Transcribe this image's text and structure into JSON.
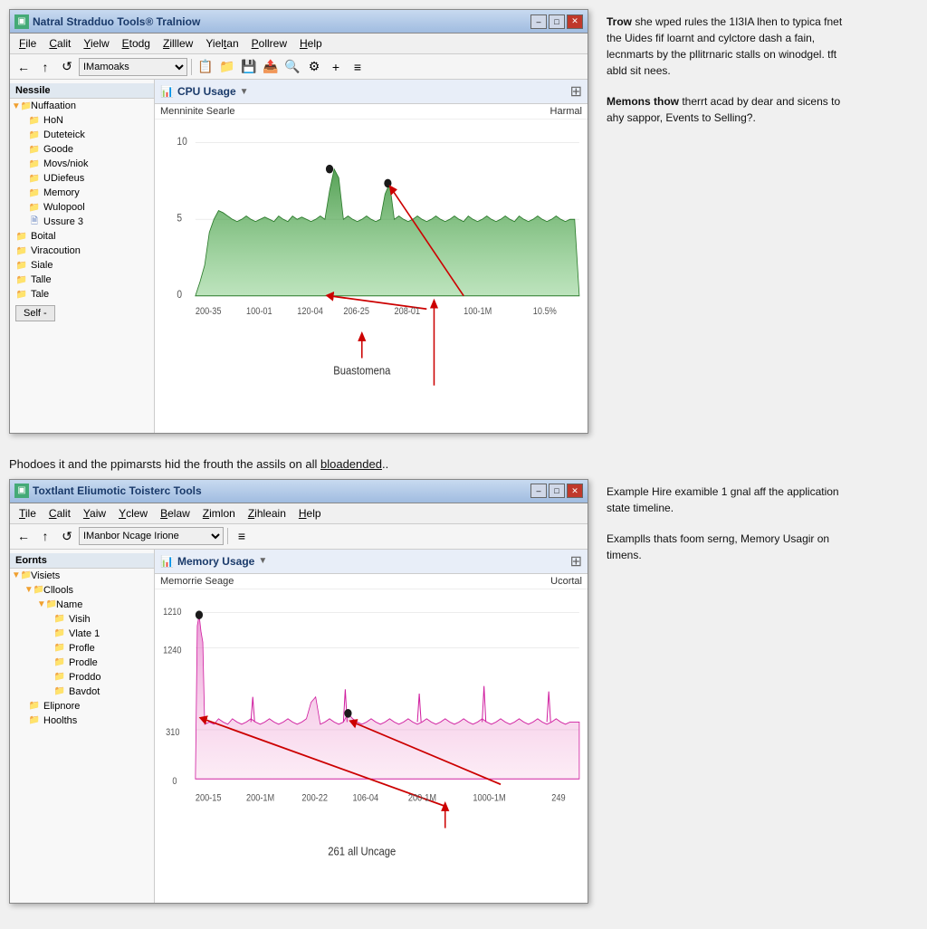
{
  "app1": {
    "title": "Natral Stradduo Tools® Tralniow",
    "menu": [
      "File",
      "Calit",
      "Yielw",
      "Etodg",
      "Zilllew",
      "Yieltan",
      "Pollrew",
      "Help"
    ],
    "toolbar_combo": "IMamoaks",
    "sidebar_header": "Nessile",
    "sidebar_items": [
      {
        "label": "Nuffaation",
        "indent": 0,
        "type": "folder"
      },
      {
        "label": "HoN",
        "indent": 1,
        "type": "folder"
      },
      {
        "label": "Duteteick",
        "indent": 1,
        "type": "folder"
      },
      {
        "label": "Goode",
        "indent": 1,
        "type": "folder"
      },
      {
        "label": "Movs/niok",
        "indent": 1,
        "type": "folder"
      },
      {
        "label": "UDiefeus",
        "indent": 1,
        "type": "folder"
      },
      {
        "label": "Memory",
        "indent": 1,
        "type": "folder"
      },
      {
        "label": "Wulopool",
        "indent": 1,
        "type": "folder"
      },
      {
        "label": "Ussure 3",
        "indent": 1,
        "type": "file"
      },
      {
        "label": "Boital",
        "indent": 0,
        "type": "folder"
      },
      {
        "label": "Viracoution",
        "indent": 0,
        "type": "folder"
      },
      {
        "label": "Siale",
        "indent": 0,
        "type": "folder"
      },
      {
        "label": "Talle",
        "indent": 0,
        "type": "folder"
      },
      {
        "label": "Tale",
        "indent": 0,
        "type": "folder"
      }
    ],
    "sidebar_btn": "Self -",
    "panel_title": "CPU Usage",
    "panel_subtitle_left": "Menninite Searle",
    "panel_subtitle_right": "Harmal",
    "chart_y_labels": [
      "10",
      "5",
      "0"
    ],
    "chart_x_labels": [
      "200-35",
      "100-01",
      "120-04",
      "206-25",
      "208-01",
      "100-1M",
      "10.5%"
    ],
    "balloon_text": "Buastomena",
    "annotation1_title": "Trow",
    "annotation1_body": "she wped rules the 1I3IA lhen to typica fnet the Uides fif loarnt and cylctore dash a fain, lecnmarts by the pllitrnaric stalls on winodgel. tft abld sit nees.",
    "annotation2_title": "Memons thow",
    "annotation2_body": "therrt acad by dear and sicens to ahy sappor, Events to Selling?."
  },
  "middle_text": "Phodoes it and the ppimarsts hid the frouth the assils on all bloadended..",
  "app2": {
    "title": "Toxtlant Eliumotic Toisterc Tools",
    "menu": [
      "Tile",
      "Calit",
      "Yaiw",
      "Yclew",
      "Belaw",
      "Zimlon",
      "Zihleain",
      "Help"
    ],
    "toolbar_combo": "IManbor Ncage Irione",
    "sidebar_header": "Eornts",
    "sidebar_items": [
      {
        "label": "Visiets",
        "indent": 0,
        "type": "folder"
      },
      {
        "label": "Cllools",
        "indent": 1,
        "type": "folder"
      },
      {
        "label": "Name",
        "indent": 2,
        "type": "folder"
      },
      {
        "label": "Visih",
        "indent": 3,
        "type": "folder"
      },
      {
        "label": "Vlate 1",
        "indent": 3,
        "type": "folder"
      },
      {
        "label": "Profle",
        "indent": 3,
        "type": "folder"
      },
      {
        "label": "Prodle",
        "indent": 3,
        "type": "folder"
      },
      {
        "label": "Proddo",
        "indent": 3,
        "type": "folder"
      },
      {
        "label": "Bavdot",
        "indent": 3,
        "type": "folder"
      },
      {
        "label": "Elipnore",
        "indent": 1,
        "type": "folder"
      },
      {
        "label": "Hoolths",
        "indent": 1,
        "type": "folder"
      }
    ],
    "panel_title": "Memory Usage",
    "panel_subtitle_left": "Memorrie Seage",
    "panel_subtitle_right": "Ucortal",
    "chart_y_labels": [
      "1210",
      "1240",
      "310",
      "0"
    ],
    "chart_x_labels": [
      "200-15",
      "200-1M",
      "200-22",
      "106-04",
      "200-1M",
      "1000-1M",
      "249"
    ],
    "balloon_text": "261 all Uncage",
    "annotation1_body": "Example Hire examible 1 gnal aff the application state timeline.",
    "annotation2_body": "Examplls thats foom serng, Memory Usagir on timens."
  }
}
